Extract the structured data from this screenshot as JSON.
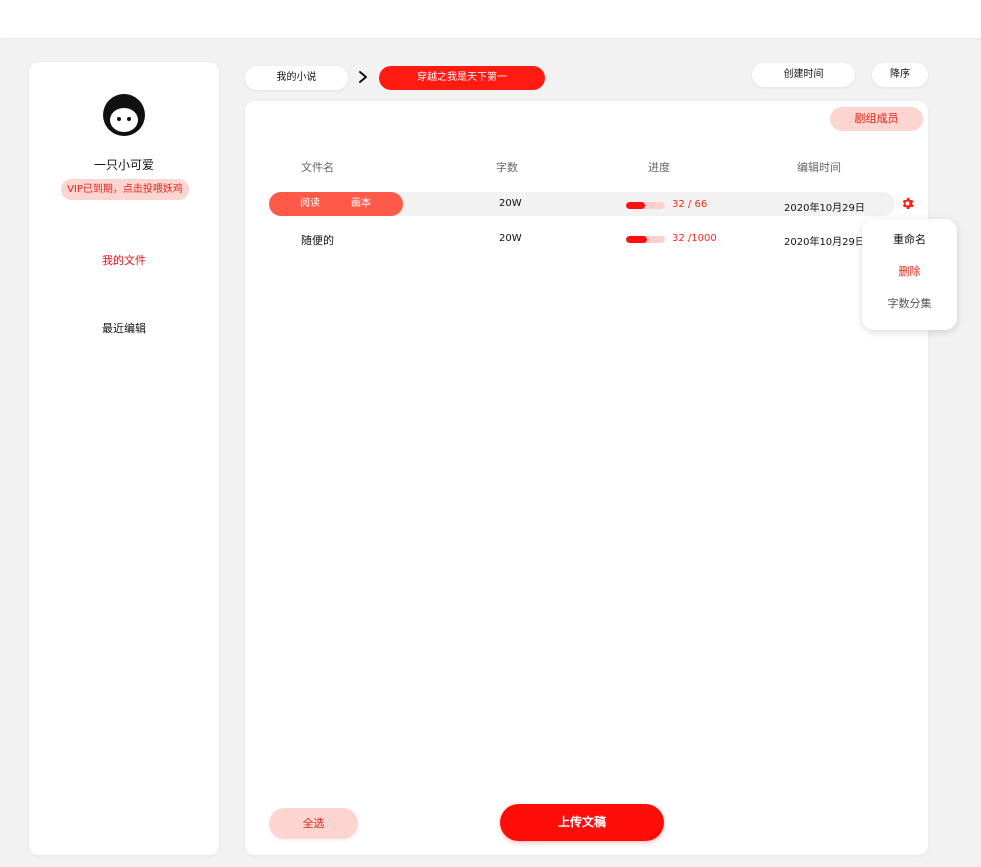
{
  "user": {
    "name": "一只小可爱",
    "vip_notice": "VIP已到期，点击投喂妖鸡"
  },
  "sidebar": {
    "items": [
      {
        "label": "我的文件",
        "active": true
      },
      {
        "label": "最近编辑",
        "active": false
      }
    ]
  },
  "breadcrumb": {
    "root": "我的小说",
    "current": "穿越之我是天下第一"
  },
  "sort": {
    "field": "创建时间",
    "order": "降序"
  },
  "toolbar": {
    "crew_label": "剧组成员"
  },
  "table": {
    "headers": [
      "文件名",
      "字数",
      "进度",
      "编辑时间"
    ],
    "row_actions": {
      "read": "阅读",
      "storyboard": "画本"
    },
    "rows": [
      {
        "name": "",
        "words": "20W",
        "progress_text": "32 / 66",
        "progress_fraction": 0.485,
        "edit_time": "2020年10月29日"
      },
      {
        "name": "随便的",
        "words": "20W",
        "progress_text": "32 /1000",
        "progress_fraction": 0.55,
        "edit_time": "2020年10月29日"
      }
    ]
  },
  "context_menu": {
    "rename": "重命名",
    "delete": "删除",
    "split": "字数分集"
  },
  "footer": {
    "select_all": "全选",
    "upload": "上传文稿"
  },
  "colors": {
    "accent": "#ff1a12",
    "accent_light": "#fcd4d0",
    "action_pill": "#ff5a49",
    "background": "#f2f2f2"
  },
  "icons": {
    "avatar": "face-avatar-icon",
    "breadcrumb_separator": "chevron-right-icon",
    "row_menu": "gear-icon"
  }
}
